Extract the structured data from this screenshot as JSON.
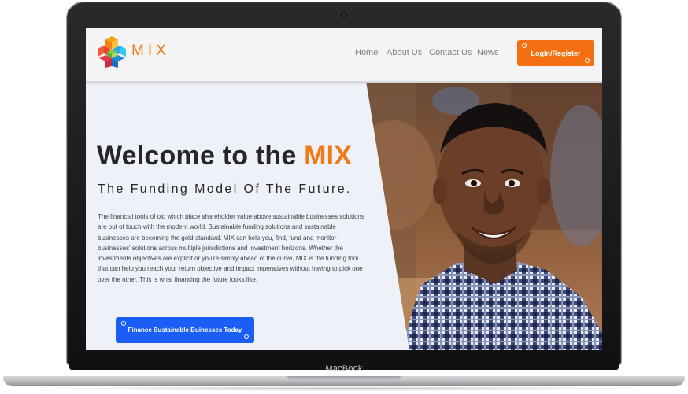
{
  "device": {
    "brand": "MacBook"
  },
  "header": {
    "logo_text": "MIX",
    "nav": {
      "home": "Home",
      "about": "About Us",
      "contact": "Contact Us",
      "news": "News"
    },
    "login_button": "Login/Register"
  },
  "hero": {
    "title_prefix": "Welcome to the ",
    "title_accent": "MIX",
    "subtitle": "The Funding Model Of The Future.",
    "body": "The financial tools of old which place shareholder value above sustainable businesses solutions are out of touch with the modern world. Sustainable funding solutions and sustainable businesses are becoming the gold-standard. MIX can help you, find, fund and monitor businesses' solutions across multiple jurisdictions and investment horizons. Whether the investments objectives are explicit or you're simply ahead of the curve, MIX is the funding tool that can help you reach your return objective and impact imperatives without having to pick one over the other. This is what financing the future looks like.",
    "cta_button": "Finance Sustainable Buinesses Today"
  },
  "colors": {
    "accent_orange": "#f36f12",
    "cta_blue": "#1a5ef5",
    "hero_background": "#eef1f7",
    "title_dark": "#25262b"
  },
  "icons": {
    "logo": "mix-cube-logo-icon",
    "camera": "webcam-icon"
  }
}
